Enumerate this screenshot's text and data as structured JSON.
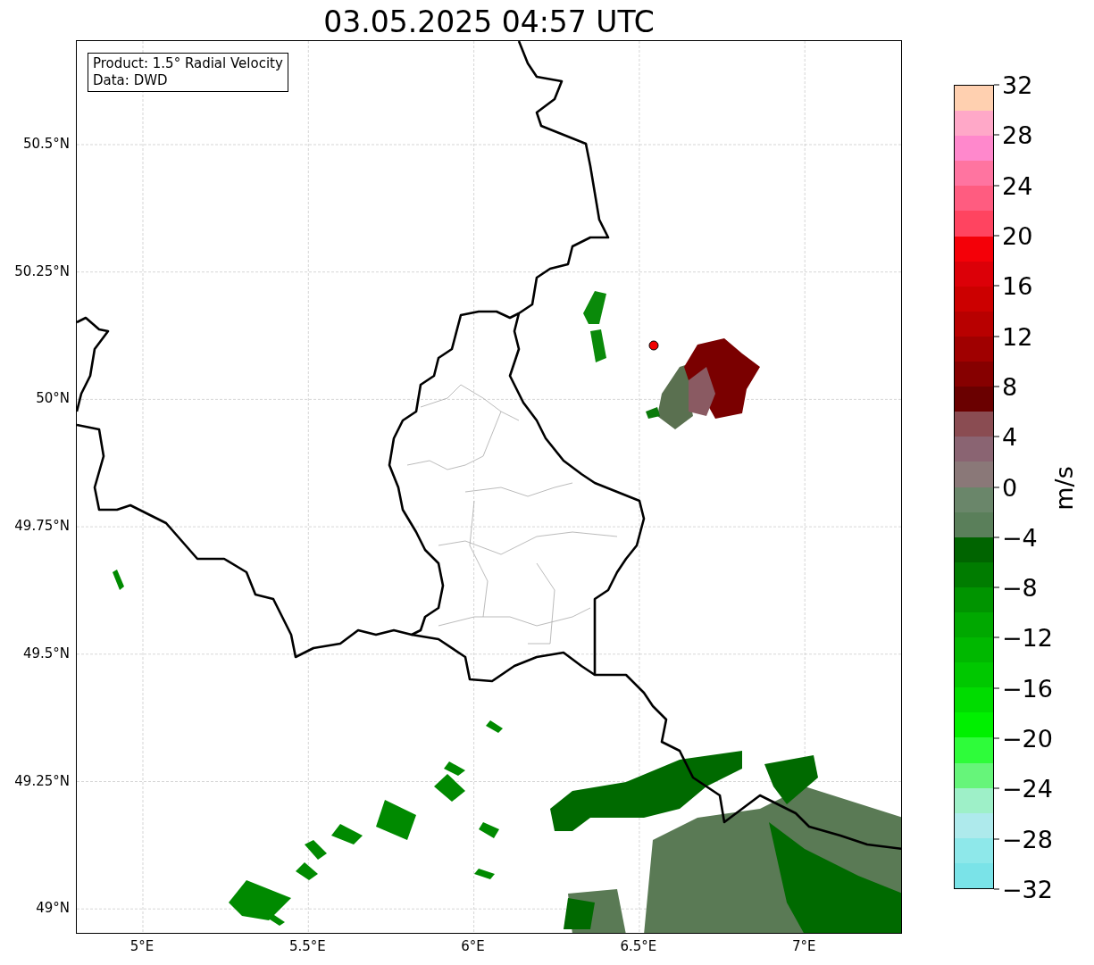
{
  "title": "03.05.2025 04:57 UTC",
  "info_box": [
    "Product: 1.5° Radial Velocity",
    "Data: DWD"
  ],
  "lat_ticks": [
    "50.5°N",
    "50.25°N",
    "50°N",
    "49.75°N",
    "49.5°N",
    "49.25°N",
    "49°N"
  ],
  "lon_ticks": [
    "5°E",
    "5.5°E",
    "6°E",
    "6.5°E",
    "7°E"
  ],
  "colorbar": {
    "label": "m/s",
    "ticks": [
      "32",
      "28",
      "24",
      "20",
      "16",
      "12",
      "8",
      "4",
      "0",
      "−4",
      "−8",
      "−12",
      "−16",
      "−20",
      "−24",
      "−28",
      "−32"
    ],
    "segments": [
      {
        "color": "#ffd0b0"
      },
      {
        "color": "#ffa8c8"
      },
      {
        "color": "#ff88cc"
      },
      {
        "color": "#ff74a0"
      },
      {
        "color": "#ff5c80"
      },
      {
        "color": "#ff4460"
      },
      {
        "color": "#f40008"
      },
      {
        "color": "#dc0008"
      },
      {
        "color": "#cc0000"
      },
      {
        "color": "#b80000"
      },
      {
        "color": "#a00000"
      },
      {
        "color": "#860000"
      },
      {
        "color": "#6a0000"
      },
      {
        "color": "#8a4c52"
      },
      {
        "color": "#8a6472"
      },
      {
        "color": "#8a7878"
      },
      {
        "color": "#6a866a"
      },
      {
        "color": "#5a7f5a"
      },
      {
        "color": "#006400"
      },
      {
        "color": "#007c00"
      },
      {
        "color": "#009400"
      },
      {
        "color": "#00a800"
      },
      {
        "color": "#00b800"
      },
      {
        "color": "#00c800"
      },
      {
        "color": "#00dc00"
      },
      {
        "color": "#00f000"
      },
      {
        "color": "#2efc3a"
      },
      {
        "color": "#66f57a"
      },
      {
        "color": "#9ef0c8"
      },
      {
        "color": "#aeeaec"
      },
      {
        "color": "#8ee8ea"
      },
      {
        "color": "#7ae3e8"
      }
    ]
  }
}
